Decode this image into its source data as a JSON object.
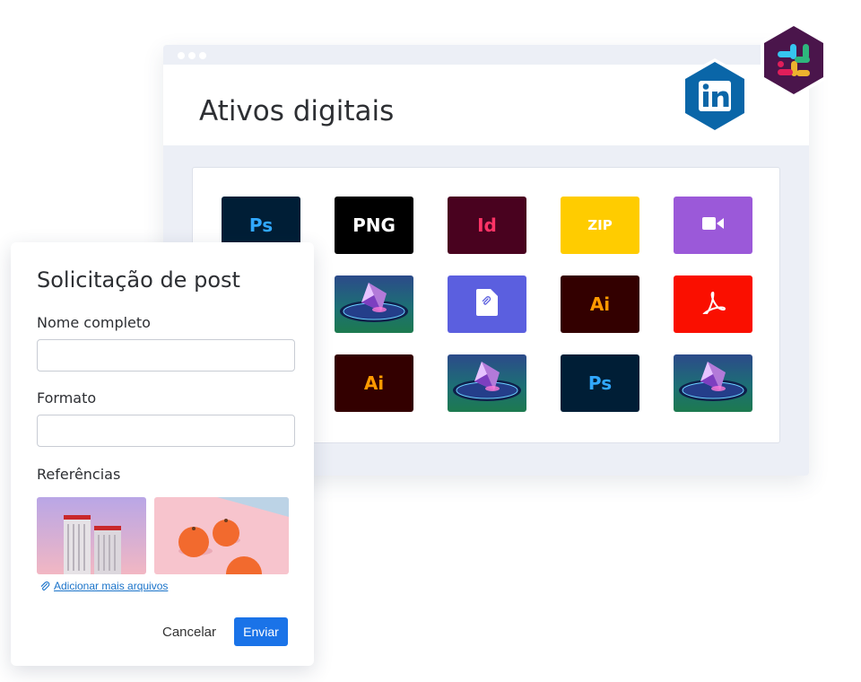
{
  "assets_window": {
    "title": "Ativos digitais",
    "tiles": [
      {
        "kind": "text",
        "label": "Ps",
        "bg": "#001e36",
        "fg": "#31a8ff",
        "icon": "photoshop-icon"
      },
      {
        "kind": "text",
        "label": "PNG",
        "bg": "#000000",
        "fg": "#ffffff",
        "icon": "png-file-icon"
      },
      {
        "kind": "text",
        "label": "Id",
        "bg": "#49021f",
        "fg": "#ff3366",
        "icon": "indesign-icon"
      },
      {
        "kind": "text",
        "label": "ZIP",
        "bg": "#ffcc00",
        "fg": "#ffffff",
        "icon": "zip-file-icon"
      },
      {
        "kind": "icon",
        "label": "",
        "bg": "#9b59d9",
        "fg": "#ffffff",
        "icon": "video-camera-icon"
      },
      {
        "kind": "photo",
        "label": "",
        "bg": "#1d6f75",
        "fg": "",
        "icon": "image-thumbnail"
      },
      {
        "kind": "icon",
        "label": "",
        "bg": "#5b5fdf",
        "fg": "#ffffff",
        "icon": "attachment-file-icon"
      },
      {
        "kind": "text",
        "label": "Ai",
        "bg": "#330000",
        "fg": "#ff9a00",
        "icon": "illustrator-icon"
      },
      {
        "kind": "icon",
        "label": "",
        "bg": "#fa0f00",
        "fg": "#ffffff",
        "icon": "acrobat-pdf-icon"
      },
      {
        "kind": "text",
        "label": "Ai",
        "bg": "#330000",
        "fg": "#ff9a00",
        "icon": "illustrator-icon"
      },
      {
        "kind": "photo",
        "label": "",
        "bg": "#1d6f75",
        "fg": "",
        "icon": "image-thumbnail"
      },
      {
        "kind": "text",
        "label": "Ps",
        "bg": "#001e36",
        "fg": "#31a8ff",
        "icon": "photoshop-icon"
      },
      {
        "kind": "photo",
        "label": "",
        "bg": "#1d6f75",
        "fg": "",
        "icon": "image-thumbnail"
      }
    ]
  },
  "badges": [
    {
      "icon": "linkedin-icon",
      "color": "#0a66a8",
      "text": "in"
    },
    {
      "icon": "slack-icon",
      "color": "#4a154b",
      "text": ""
    }
  ],
  "form": {
    "title": "Solicitação de post",
    "name_label": "Nome completo",
    "name_value": "",
    "format_label": "Formato",
    "format_value": "",
    "references_label": "Referências",
    "add_files_label": "Adicionar mais arquivos",
    "cancel_label": "Cancelar",
    "submit_label": "Enviar",
    "submit_color": "#1a73e8",
    "link_color": "#1a73c9"
  }
}
